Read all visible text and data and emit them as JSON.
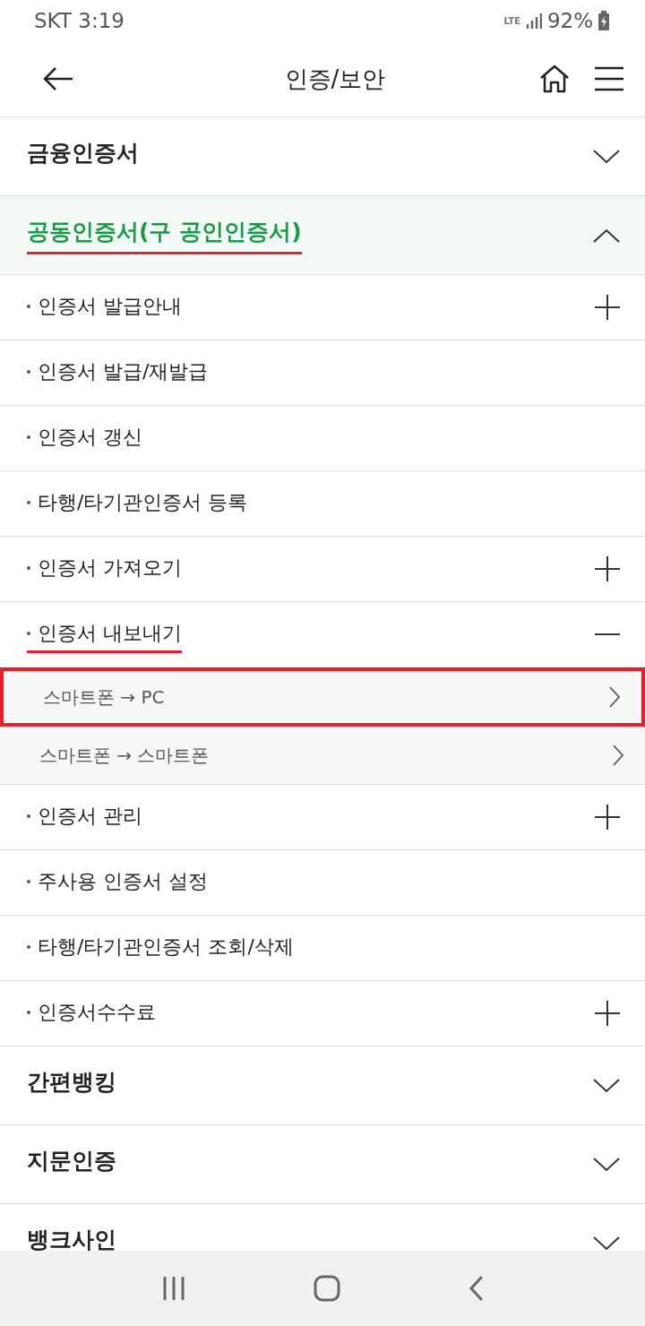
{
  "status_bar": {
    "carrier_time": "SKT 3:19",
    "network": "LTE",
    "battery": "92%"
  },
  "header": {
    "title": "인증/보안"
  },
  "sections": [
    {
      "title": "금융인증서",
      "expanded": false,
      "underlined": false
    },
    {
      "title": "공동인증서(구 공인인증서)",
      "expanded": true,
      "underlined": true,
      "items": [
        {
          "label": "인증서 발급안내",
          "kind": "expandable",
          "expanded": false,
          "underlined": false
        },
        {
          "label": "인증서 발급/재발급",
          "kind": "link",
          "underlined": false
        },
        {
          "label": "인증서 갱신",
          "kind": "link",
          "underlined": false
        },
        {
          "label": "타행/타기관인증서 등록",
          "kind": "link",
          "underlined": false
        },
        {
          "label": "인증서 가져오기",
          "kind": "expandable",
          "expanded": false,
          "underlined": false
        },
        {
          "label": "인증서 내보내기",
          "kind": "expandable",
          "expanded": true,
          "underlined": true,
          "children": [
            {
              "label": "스마트폰 → PC",
              "boxed": true
            },
            {
              "label": "스마트폰 → 스마트폰",
              "boxed": false
            }
          ]
        },
        {
          "label": "인증서 관리",
          "kind": "expandable",
          "expanded": false,
          "underlined": false
        },
        {
          "label": "주사용 인증서 설정",
          "kind": "link",
          "underlined": false
        },
        {
          "label": "타행/타기관인증서 조회/삭제",
          "kind": "link",
          "underlined": false
        },
        {
          "label": "인증서수수료",
          "kind": "expandable",
          "expanded": false,
          "underlined": false
        }
      ]
    },
    {
      "title": "간편뱅킹",
      "expanded": false,
      "underlined": false
    },
    {
      "title": "지문인증",
      "expanded": false,
      "underlined": false
    },
    {
      "title": "뱅크사인",
      "expanded": false
    }
  ]
}
